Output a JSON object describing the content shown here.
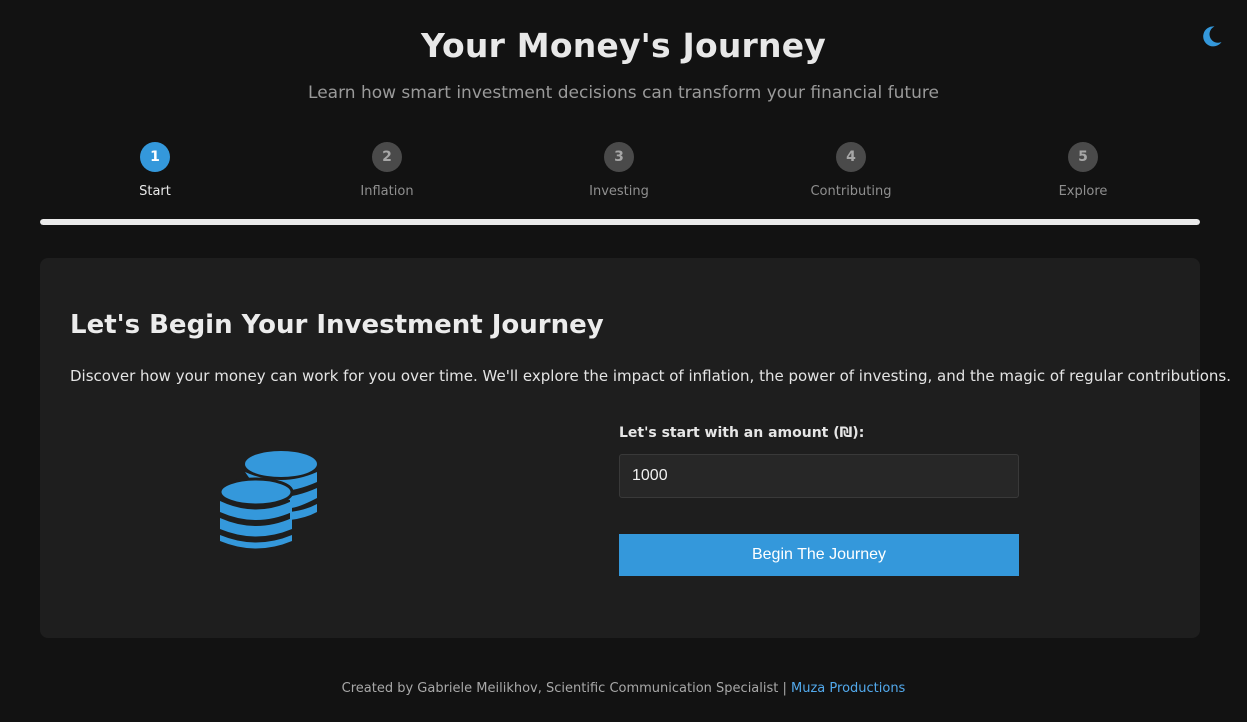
{
  "header": {
    "title": "Your Money's Journey",
    "subtitle": "Learn how smart investment decisions can transform your financial future",
    "theme_toggle_icon": "moon-icon"
  },
  "steps": [
    {
      "number": "1",
      "label": "Start",
      "active": true
    },
    {
      "number": "2",
      "label": "Inflation",
      "active": false
    },
    {
      "number": "3",
      "label": "Investing",
      "active": false
    },
    {
      "number": "4",
      "label": "Contributing",
      "active": false
    },
    {
      "number": "5",
      "label": "Explore",
      "active": false
    }
  ],
  "progress": {
    "fraction": 1.0
  },
  "card": {
    "title": "Let's Begin Your Investment Journey",
    "description": "Discover how your money can work for you over time. We'll explore the impact of inflation, the power of investing, and the magic of regular contributions.",
    "illustration_icon": "coins-icon",
    "amount_label": "Let's start with an amount (₪):",
    "amount_value": "1000",
    "begin_button_label": "Begin The Journey"
  },
  "footer": {
    "credit_text": "Created by Gabriele Meilikhov, Scientific Communication Specialist | ",
    "link_text": "Muza Productions"
  },
  "colors": {
    "accent": "#3498db",
    "background": "#121212",
    "card": "#1e1e1e",
    "link": "#52a9ec"
  }
}
